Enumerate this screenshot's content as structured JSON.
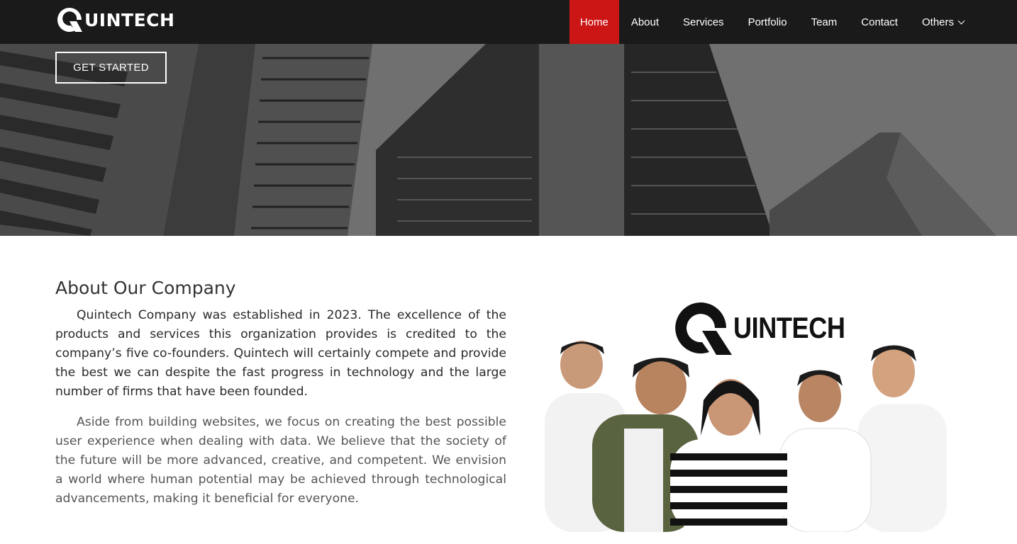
{
  "header": {
    "logo_text": "UINTECH",
    "nav": [
      {
        "label": "Home",
        "active": true
      },
      {
        "label": "About"
      },
      {
        "label": "Services"
      },
      {
        "label": "Portfolio"
      },
      {
        "label": "Team"
      },
      {
        "label": "Contact"
      },
      {
        "label": "Others",
        "has_dropdown": true
      }
    ]
  },
  "hero": {
    "cta_label": "GET STARTED"
  },
  "about": {
    "title": "About Our Company",
    "paragraph_1": "Quintech Company was established in 2023. The excellence of the products and services this organization provides is credited to the company’s five co-founders. Quintech will certainly compete and provide the best we can despite the fast progress in technology and the large number of firms that have been founded.",
    "paragraph_2": "Aside from building websites, we focus on creating the best possible user experience when dealing with data. We believe that the society of the future will be more advanced, creative, and competent. We envision a world where human potential may be achieved through technological advancements, making it beneficial for everyone."
  },
  "team_image": {
    "logo_text": "UINTECH"
  },
  "colors": {
    "header_bg": "#1a1a1a",
    "accent": "#cc1616"
  }
}
